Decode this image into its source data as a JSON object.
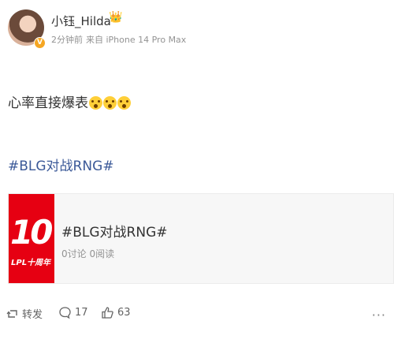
{
  "user": {
    "name": "小钰_Hilda",
    "time": "2分钟前",
    "source": "来自 iPhone 14 Pro Max",
    "verified_badge": "V"
  },
  "post": {
    "text": "心率直接爆表",
    "emoji_count": 3,
    "hashtag": "#BLG对战RNG#"
  },
  "topic_card": {
    "badge_number": "10",
    "badge_text": "LPL十周年",
    "title": "#BLG对战RNG#",
    "stats": "0讨论 0阅读"
  },
  "actions": {
    "repost_label": "转发",
    "comment_count": "17",
    "like_count": "63",
    "more": "···"
  },
  "colors": {
    "link": "#3b5998",
    "card_badge": "#e60012",
    "verified": "#f5a623"
  }
}
